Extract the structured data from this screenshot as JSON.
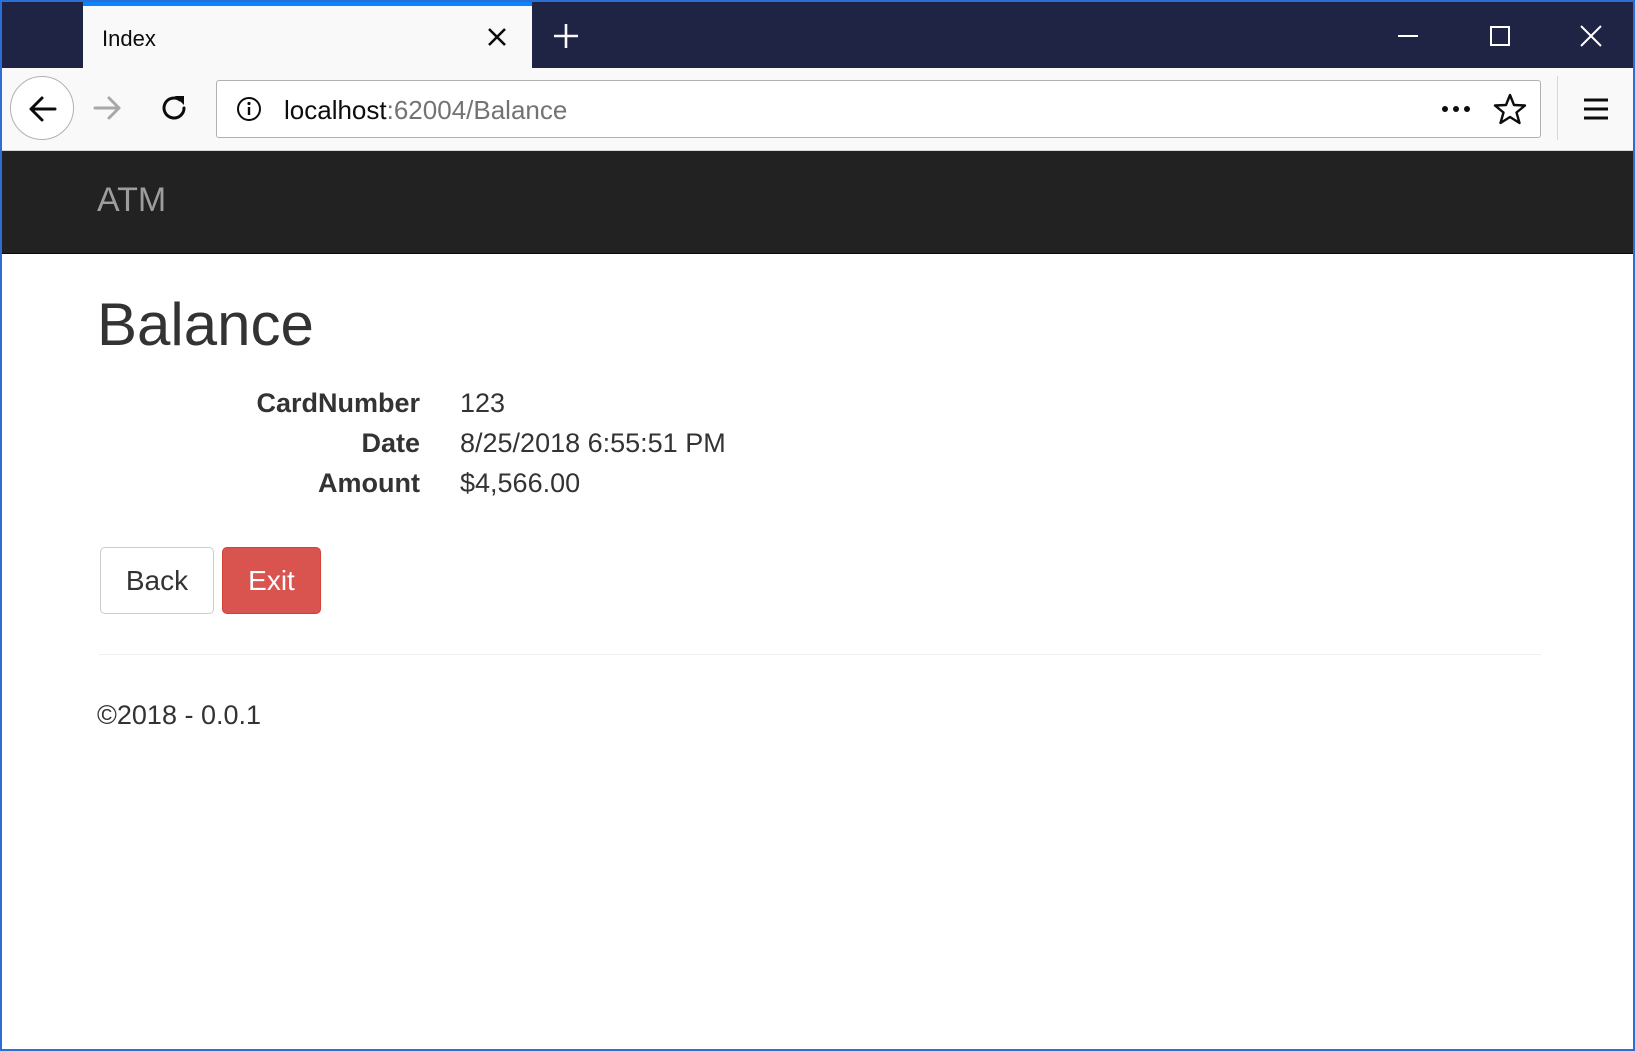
{
  "browser": {
    "tab_title": "Index",
    "url_host": "localhost",
    "url_rest": ":62004/Balance"
  },
  "site": {
    "brand": "ATM"
  },
  "page": {
    "title": "Balance",
    "fields": [
      {
        "label": "CardNumber",
        "value": "123"
      },
      {
        "label": "Date",
        "value": "8/25/2018 6:55:51 PM"
      },
      {
        "label": "Amount",
        "value": "$4,566.00"
      }
    ],
    "back_label": "Back",
    "exit_label": "Exit"
  },
  "footer": {
    "text": "©2018 - 0.0.1"
  },
  "colors": {
    "tabbar": "#1f2344",
    "navbar": "#222222",
    "danger": "#d9534f",
    "accent": "#0a84ff"
  },
  "icons": [
    "close-icon",
    "plus-icon",
    "minimize-icon",
    "maximize-icon",
    "back-arrow-icon",
    "forward-arrow-icon",
    "reload-icon",
    "info-icon",
    "more-icon",
    "star-icon",
    "hamburger-menu-icon"
  ]
}
